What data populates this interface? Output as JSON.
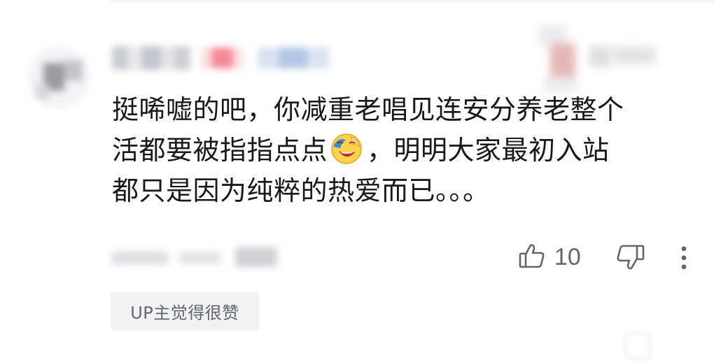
{
  "comment": {
    "lines": [
      "挺唏嘘的吧，你减重老唱见连安分养老整个",
      "活都要被指指点点",
      "，明明大家最初入站",
      "都只是因为纯粹的热爱而已。。。"
    ],
    "emoji": "facepalm-laughing-emoji"
  },
  "actions": {
    "like_count": "10",
    "like_icon": "thumbs-up-icon",
    "dislike_icon": "thumbs-down-icon",
    "more_icon": "more-vertical-icon"
  },
  "tag": {
    "label": "UP主觉得很赞"
  },
  "colors": {
    "text": "#18191c",
    "secondary": "#61666d",
    "tag_background": "#f1f2f3",
    "level_badge": "#f58a95",
    "medal": "#b3c6e6"
  }
}
